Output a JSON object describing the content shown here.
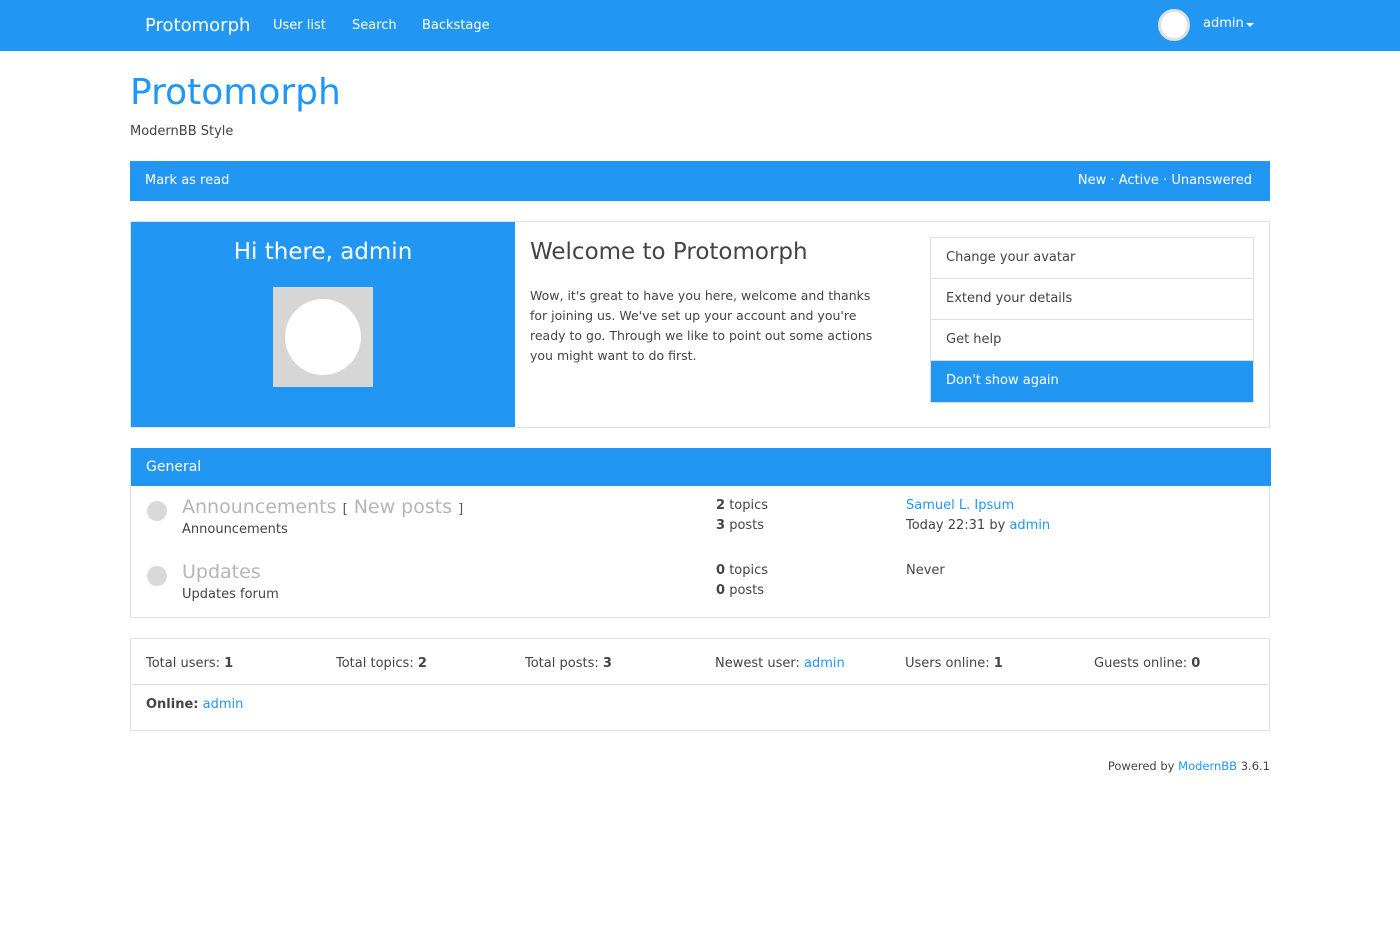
{
  "navbar": {
    "brand": "Protomorph",
    "links": [
      "User list",
      "Search",
      "Backstage"
    ],
    "user": "admin"
  },
  "header": {
    "title": "Protomorph",
    "description": "ModernBB Style"
  },
  "statusbar": {
    "mark_read": "Mark as read",
    "quick_links": [
      "New",
      "Active",
      "Unanswered"
    ]
  },
  "welcome": {
    "greeting": "Hi there, admin",
    "title": "Welcome to Protomorph",
    "text": "Wow, it's great to have you here, welcome and thanks for joining us. We've set up your account and you're ready to go. Through we like to point out some actions you might want to do first.",
    "actions": [
      "Change your avatar",
      "Extend your details",
      "Get help",
      "Don't show again"
    ]
  },
  "category": {
    "title": "General",
    "forums": [
      {
        "name": "Announcements",
        "new_posts_label": "New posts",
        "description": "Announcements",
        "topics": "2",
        "topics_label": "topics",
        "posts": "3",
        "posts_label": "posts",
        "last_post_title": "Samuel L. Ipsum",
        "last_post_time": "Today 22:31",
        "last_post_by": "by",
        "last_post_user": "admin"
      },
      {
        "name": "Updates",
        "description": "Updates forum",
        "topics": "0",
        "topics_label": "topics",
        "posts": "0",
        "posts_label": "posts",
        "last_post": "Never"
      }
    ]
  },
  "boardstats": {
    "total_users_label": "Total users:",
    "total_users": "1",
    "total_topics_label": "Total topics:",
    "total_topics": "2",
    "total_posts_label": "Total posts:",
    "total_posts": "3",
    "newest_user_label": "Newest user:",
    "newest_user": "admin",
    "users_online_label": "Users online:",
    "users_online": "1",
    "guests_online_label": "Guests online:",
    "guests_online": "0",
    "online_label": "Online:",
    "online_users": "admin"
  },
  "footer": {
    "powered_by": "Powered by",
    "product": "ModernBB",
    "version": "3.6.1"
  },
  "colors": {
    "accent": "#2196f3",
    "muted_forum": "#b5b5b5"
  }
}
